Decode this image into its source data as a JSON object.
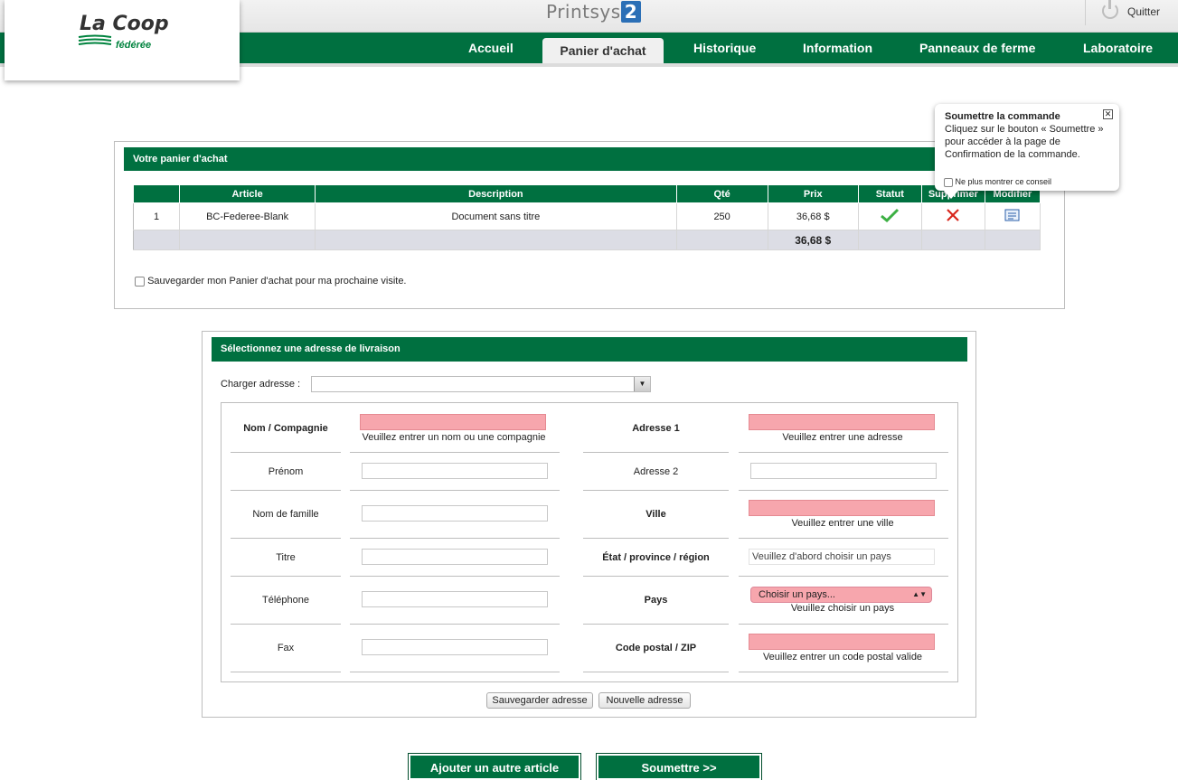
{
  "app": {
    "brand_text": "Printsys",
    "brand_number": "2",
    "logo_main": "La Coop",
    "logo_sub": "fédérée",
    "quit_label": "Quitter",
    "accent_color": "#007040"
  },
  "nav": {
    "items": [
      "Accueil",
      "Panier d'achat",
      "Historique",
      "Information",
      "Panneaux de ferme",
      "Laboratoire"
    ],
    "active": "Panier d'achat"
  },
  "tooltip": {
    "title": "Soumettre la commande",
    "body": "Cliquez sur le bouton « Soumettre » pour accéder à la page de Confirmation de la commande.",
    "dont_show": "Ne plus montrer ce conseil"
  },
  "cart": {
    "title": "Votre panier d'achat",
    "columns": [
      "",
      "Article",
      "Description",
      "Qté",
      "Prix",
      "Statut",
      "Supprimer",
      "Modifier"
    ],
    "rows": [
      {
        "num": "1",
        "article": "BC-Federee-Blank",
        "description": "Document sans titre",
        "qty": "250",
        "price": "36,68 $"
      }
    ],
    "total": "36,68 $",
    "save_label": "Sauvegarder mon Panier d'achat pour ma prochaine visite."
  },
  "address": {
    "title": "Sélectionnez une adresse de livraison",
    "load_label": "Charger adresse :",
    "left_fields": [
      {
        "label": "Nom / Compagnie",
        "hint": "Veuillez entrer un nom ou une compagnie"
      },
      {
        "label": "Prénom"
      },
      {
        "label": "Nom de famille"
      },
      {
        "label": "Titre"
      },
      {
        "label": "Téléphone"
      },
      {
        "label": "Fax"
      }
    ],
    "right_fields": [
      {
        "label": "Adresse 1",
        "hint": "Veuillez entrer une adresse"
      },
      {
        "label": "Adresse 2"
      },
      {
        "label": "Ville",
        "hint": "Veuillez entrer une ville"
      },
      {
        "label": "État / province / région",
        "value": "Veuillez d'abord choisir un pays"
      },
      {
        "label": "Pays",
        "value": "Choisir un pays...",
        "hint": "Veuillez choisir un pays"
      },
      {
        "label": "Code postal / ZIP",
        "hint": "Veuillez entrer un code postal valide"
      }
    ],
    "save_button": "Sauvegarder adresse",
    "new_button": "Nouvelle adresse"
  },
  "actions": {
    "add_item": "Ajouter un autre article",
    "submit": "Soumettre >>"
  }
}
